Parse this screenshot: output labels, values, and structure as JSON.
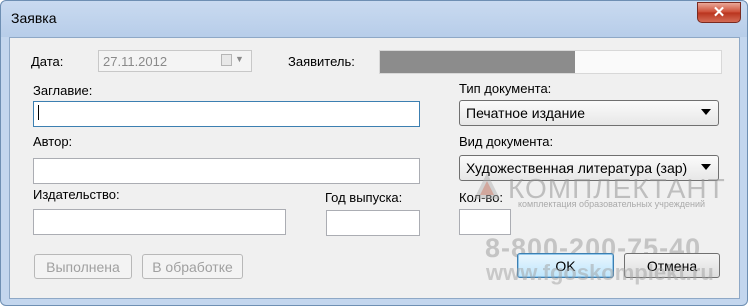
{
  "window": {
    "title": "Заявка",
    "close_glyph": "✕"
  },
  "form": {
    "date_label": "Дата:",
    "date_value": "27.11.2012",
    "applicant_label": "Заявитель:",
    "title_label": "Заглавие:",
    "title_value": "",
    "author_label": "Автор:",
    "author_value": "",
    "publisher_label": "Издательство:",
    "publisher_value": "",
    "year_label": "Год выпуска:",
    "year_value": "",
    "doc_type_label": "Тип документа:",
    "doc_type_value": "Печатное издание",
    "doc_kind_label": "Вид документа:",
    "doc_kind_value": "Художественная литература (зар)",
    "count_label": "Кол-во:",
    "count_value": ""
  },
  "buttons": {
    "done": "Выполнена",
    "in_progress": "В обработке",
    "ok": "OK",
    "cancel": "Отмена"
  },
  "watermark": {
    "brand": "КОМПЛЕКТАНТ",
    "subtitle": "комплектация образовательных учреждений",
    "phone": "8-800-200-75-40",
    "site": "www.fgoskomplekt.ru"
  },
  "colors": {
    "titlebar": "#b7cde9",
    "client": "#f0f0f0",
    "close": "#cc4a33",
    "focus": "#3c7fb1"
  },
  "icons": [
    "close-icon",
    "calendar-icon",
    "dropdown-arrow-icon"
  ]
}
